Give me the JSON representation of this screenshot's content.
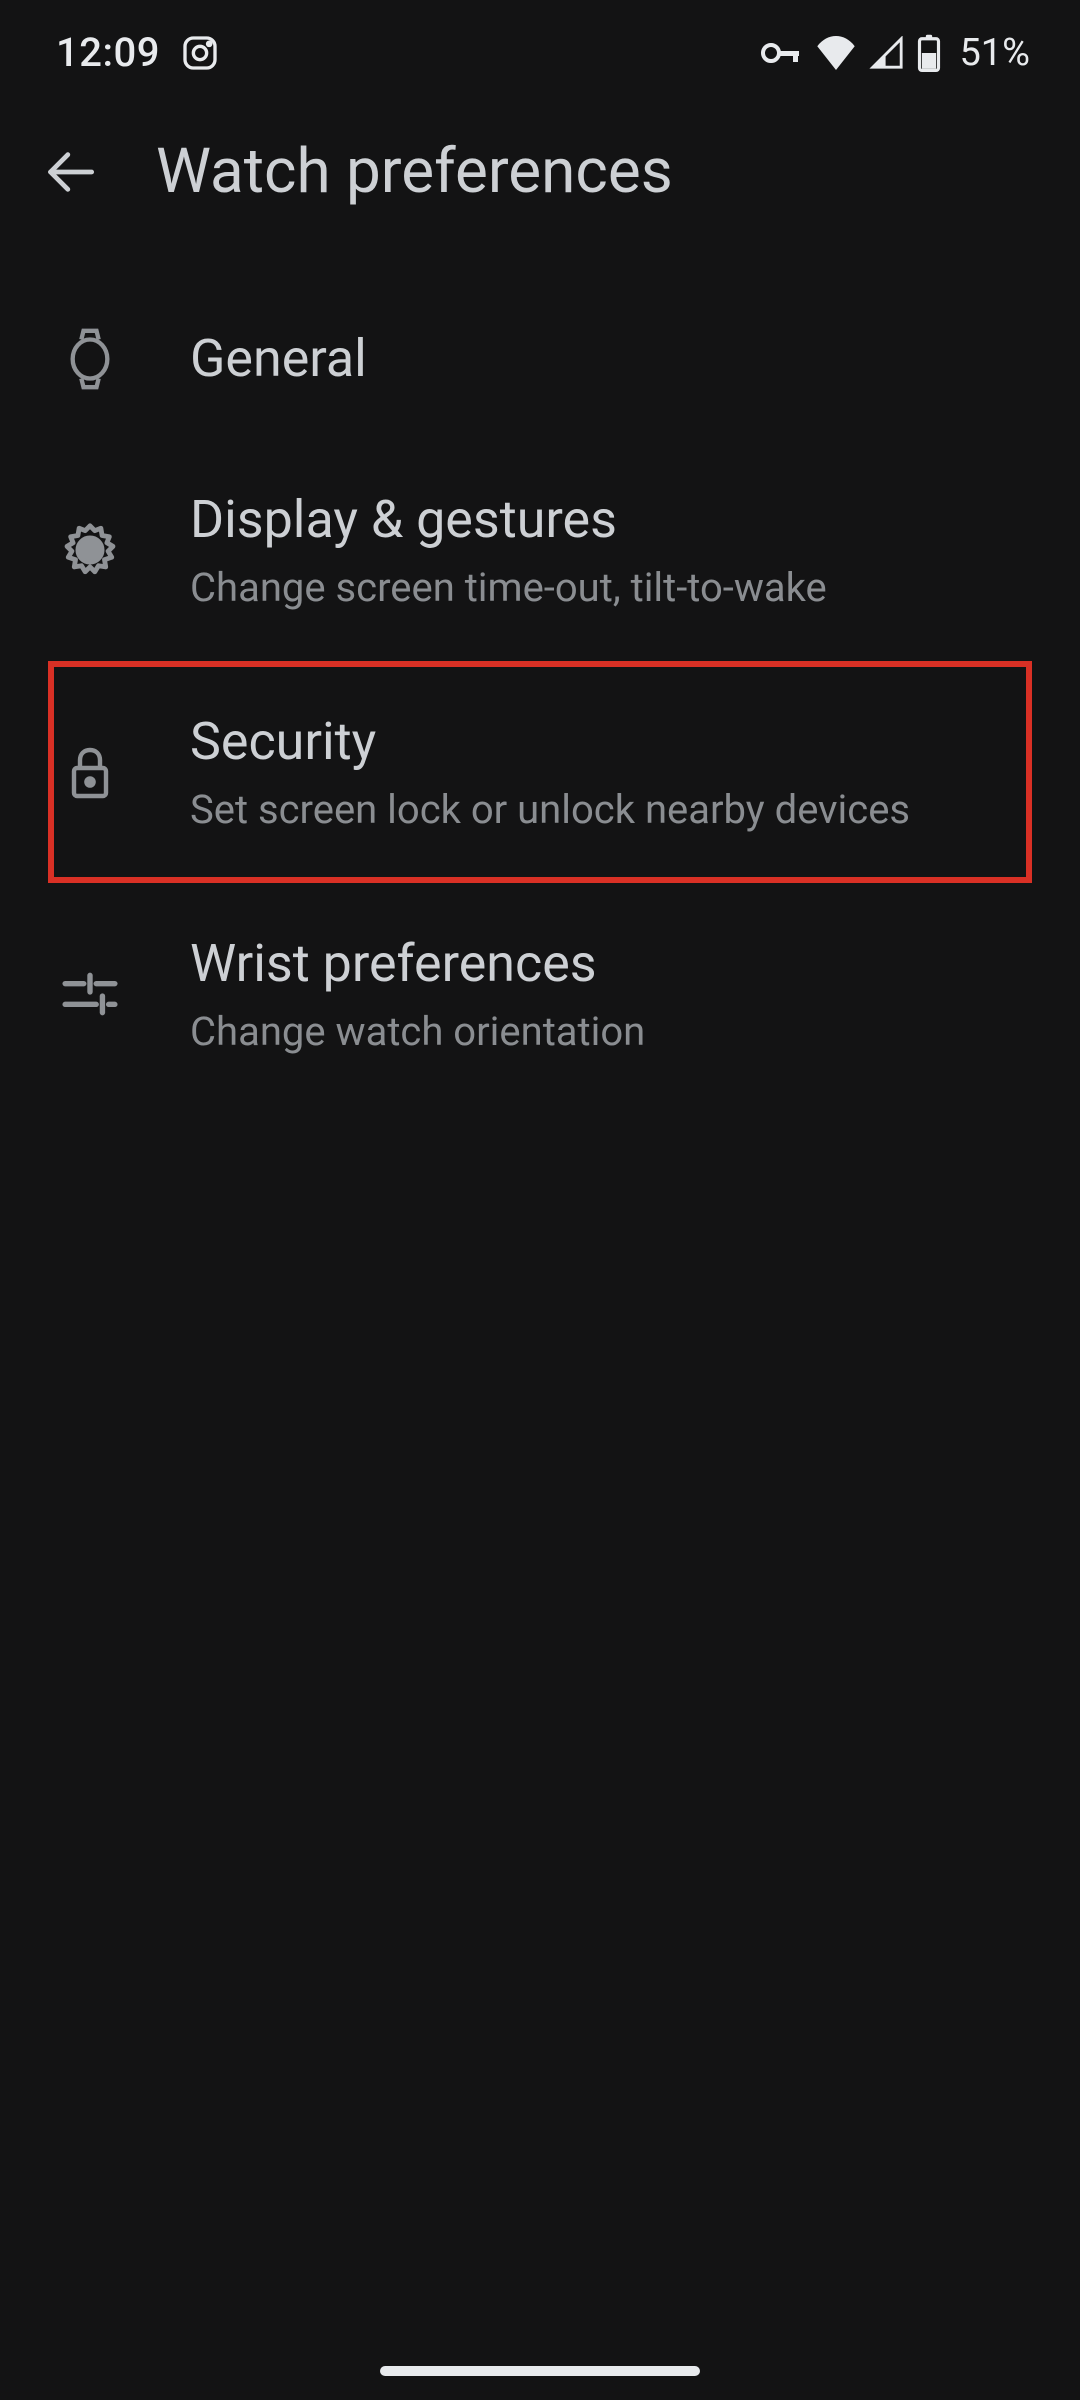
{
  "status_bar": {
    "time": "12:09",
    "battery_text": "51%"
  },
  "header": {
    "title": "Watch preferences"
  },
  "settings": {
    "items": [
      {
        "title": "General",
        "subtitle": ""
      },
      {
        "title": "Display & gestures",
        "subtitle": "Change screen time-out, tilt-to-wake"
      },
      {
        "title": "Security",
        "subtitle": "Set screen lock or unlock nearby devices"
      },
      {
        "title": "Wrist preferences",
        "subtitle": "Change watch orientation"
      }
    ]
  }
}
